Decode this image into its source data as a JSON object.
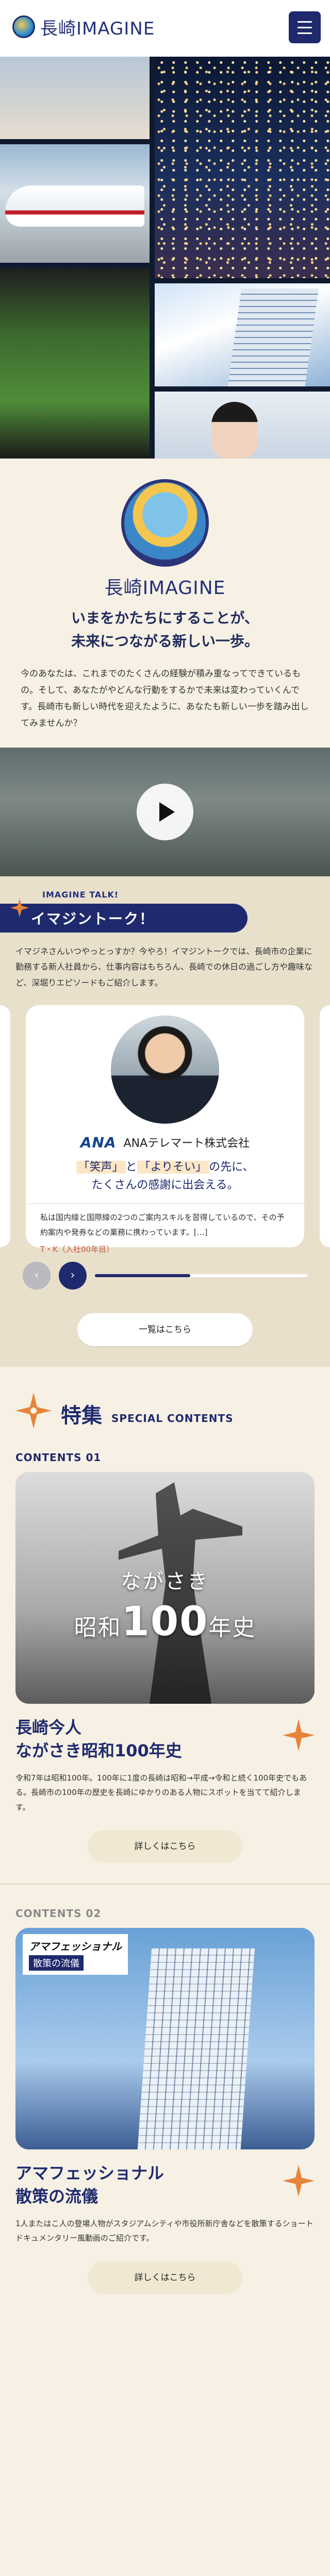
{
  "header": {
    "logo_text": "長崎IMAGINE",
    "menu_icon": "hamburger-icon"
  },
  "intro": {
    "logo_text": "長崎IMAGINE",
    "catch_line1": "いまをかたちにすることが、",
    "catch_line2": "未来につながる新しい一歩。",
    "body": "今のあなたは、これまでのたくさんの経験が積み重なってできているもの。そして、あなたがやどんな行動をするかで未来は変わっていくんです。長崎市も新しい時代を迎えたように、あなたも新しい一歩を踏み出してみませんか？"
  },
  "video": {
    "play_icon": "play-icon"
  },
  "talk": {
    "kicker": "IMAGINE TALK!",
    "title": "イマジントーク！",
    "description": "イマジネさんいつやっとっすか？今やろ！イマジントークでは、長崎市の企業に勤務する新人社員から、仕事内容はもちろん、長崎での休日の過ごし方や趣味など、深堀りエピソードもご紹介します。",
    "card": {
      "logo": "ANA",
      "company": "ANAテレマート株式会社",
      "catch_q1": "「笑声」",
      "catch_mid": "と",
      "catch_q2": "「よりそい」",
      "catch_tail": "の先に、",
      "catch_line2": "たくさんの感謝に出会える。",
      "body": "私は国内線と国際線の2つのご案内スキルを習得しているので、その予約案内や発券などの業務に携わっています。[…]",
      "author": "T・K（入社00年目）"
    },
    "prev_icon": "‹",
    "next_icon": "›",
    "progress": 0.45,
    "list_button": "一覧はこちら"
  },
  "feature": {
    "title": "特集",
    "subtitle": "SPECIAL CONTENTS",
    "items": [
      {
        "label": "CONTENTS 01",
        "hero_line1": "ながさき",
        "hero_line2_pre": "昭和",
        "hero_line2_num": "100",
        "hero_line2_post": "年史",
        "title_line1": "長崎今人",
        "title_line2": "ながさき昭和100年史",
        "desc": "令和7年は昭和100年。100年に1度の長崎は昭和→平成→令和と続く100年史でもある。長崎市の100年の歴史を長崎にゆかりのある人物にスポットを当てて紹介します。",
        "button": "詳しくはこちら"
      },
      {
        "label": "CONTENTS 02",
        "badge_line1": "アマフェッショナル",
        "badge_line2": "散策の流儀",
        "title_line1": "アマフェッショナル",
        "title_line2": "散策の流儀",
        "desc": "1人またはこ人の登場人物がスタジアムシティや市役所新庁舎などを散策するショートドキュメンタリー風動画のご紹介です。",
        "button": "詳しくはこちら"
      }
    ]
  },
  "colors": {
    "navy": "#1f2a6e",
    "cream": "#f6f1e4",
    "accent": "#e8833a"
  }
}
